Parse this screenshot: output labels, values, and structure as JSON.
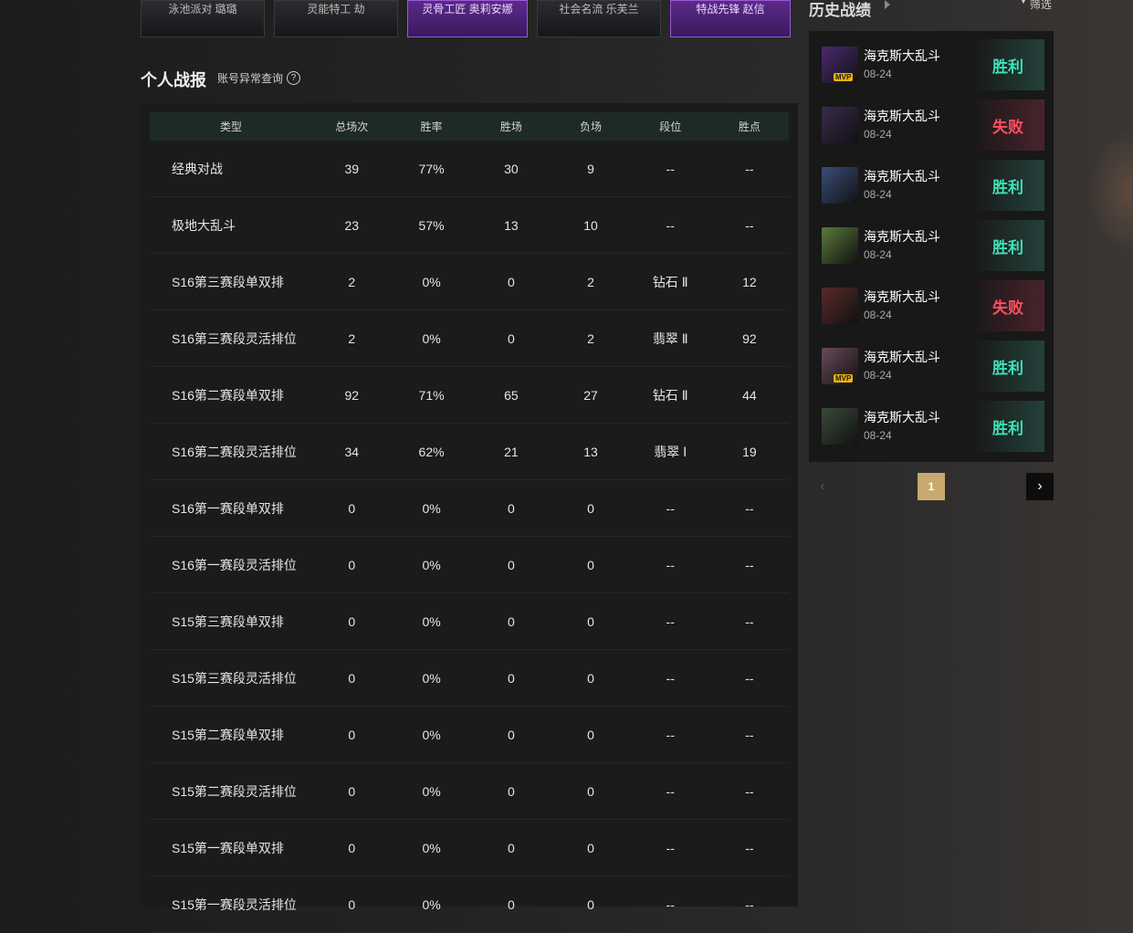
{
  "skins": [
    {
      "label": "泳池派对 璐璐",
      "selected": false
    },
    {
      "label": "灵能特工 劫",
      "selected": false
    },
    {
      "label": "灵骨工匠 奥莉安娜",
      "selected": true
    },
    {
      "label": "社会名流 乐芙兰",
      "selected": false
    },
    {
      "label": "特战先锋 赵信",
      "selected": true
    }
  ],
  "section": {
    "title": "个人战报",
    "account_link": "账号异常查询",
    "help_icon": "question-circle-icon"
  },
  "table": {
    "headers": [
      "类型",
      "总场次",
      "胜率",
      "胜场",
      "负场",
      "段位",
      "胜点"
    ],
    "rows": [
      [
        "经典对战",
        "39",
        "77%",
        "30",
        "9",
        "--",
        "--"
      ],
      [
        "极地大乱斗",
        "23",
        "57%",
        "13",
        "10",
        "--",
        "--"
      ],
      [
        "S16第三赛段单双排",
        "2",
        "0%",
        "0",
        "2",
        "钻石 Ⅱ",
        "12"
      ],
      [
        "S16第三赛段灵活排位",
        "2",
        "0%",
        "0",
        "2",
        "翡翠 Ⅱ",
        "92"
      ],
      [
        "S16第二赛段单双排",
        "92",
        "71%",
        "65",
        "27",
        "钻石 Ⅱ",
        "44"
      ],
      [
        "S16第二赛段灵活排位",
        "34",
        "62%",
        "21",
        "13",
        "翡翠 Ⅰ",
        "19"
      ],
      [
        "S16第一赛段单双排",
        "0",
        "0%",
        "0",
        "0",
        "--",
        "--"
      ],
      [
        "S16第一赛段灵活排位",
        "0",
        "0%",
        "0",
        "0",
        "--",
        "--"
      ],
      [
        "S15第三赛段单双排",
        "0",
        "0%",
        "0",
        "0",
        "--",
        "--"
      ],
      [
        "S15第三赛段灵活排位",
        "0",
        "0%",
        "0",
        "0",
        "--",
        "--"
      ],
      [
        "S15第二赛段单双排",
        "0",
        "0%",
        "0",
        "0",
        "--",
        "--"
      ],
      [
        "S15第二赛段灵活排位",
        "0",
        "0%",
        "0",
        "0",
        "--",
        "--"
      ],
      [
        "S15第一赛段单双排",
        "0",
        "0%",
        "0",
        "0",
        "--",
        "--"
      ],
      [
        "S15第一赛段灵活排位",
        "0",
        "0%",
        "0",
        "0",
        "--",
        "--"
      ]
    ]
  },
  "history": {
    "title": "历史战绩",
    "filter_label": "筛选",
    "matches": [
      {
        "mode": "海克斯大乱斗",
        "date": "08-24",
        "result": "胜利",
        "win": true,
        "mvp": true,
        "avatar_color": "#4a2a6e"
      },
      {
        "mode": "海克斯大乱斗",
        "date": "08-24",
        "result": "失败",
        "win": false,
        "mvp": false,
        "avatar_color": "#3a2a4e"
      },
      {
        "mode": "海克斯大乱斗",
        "date": "08-24",
        "result": "胜利",
        "win": true,
        "mvp": false,
        "avatar_color": "#3a4e7a"
      },
      {
        "mode": "海克斯大乱斗",
        "date": "08-24",
        "result": "胜利",
        "win": true,
        "mvp": false,
        "avatar_color": "#5a7a3a"
      },
      {
        "mode": "海克斯大乱斗",
        "date": "08-24",
        "result": "失败",
        "win": false,
        "mvp": false,
        "avatar_color": "#5a2a2a"
      },
      {
        "mode": "海克斯大乱斗",
        "date": "08-24",
        "result": "胜利",
        "win": true,
        "mvp": true,
        "avatar_color": "#6a4a5a"
      },
      {
        "mode": "海克斯大乱斗",
        "date": "08-24",
        "result": "胜利",
        "win": true,
        "mvp": false,
        "avatar_color": "#3a4a3a"
      }
    ],
    "mvp_label": "MVP"
  },
  "pager": {
    "current": "1"
  }
}
